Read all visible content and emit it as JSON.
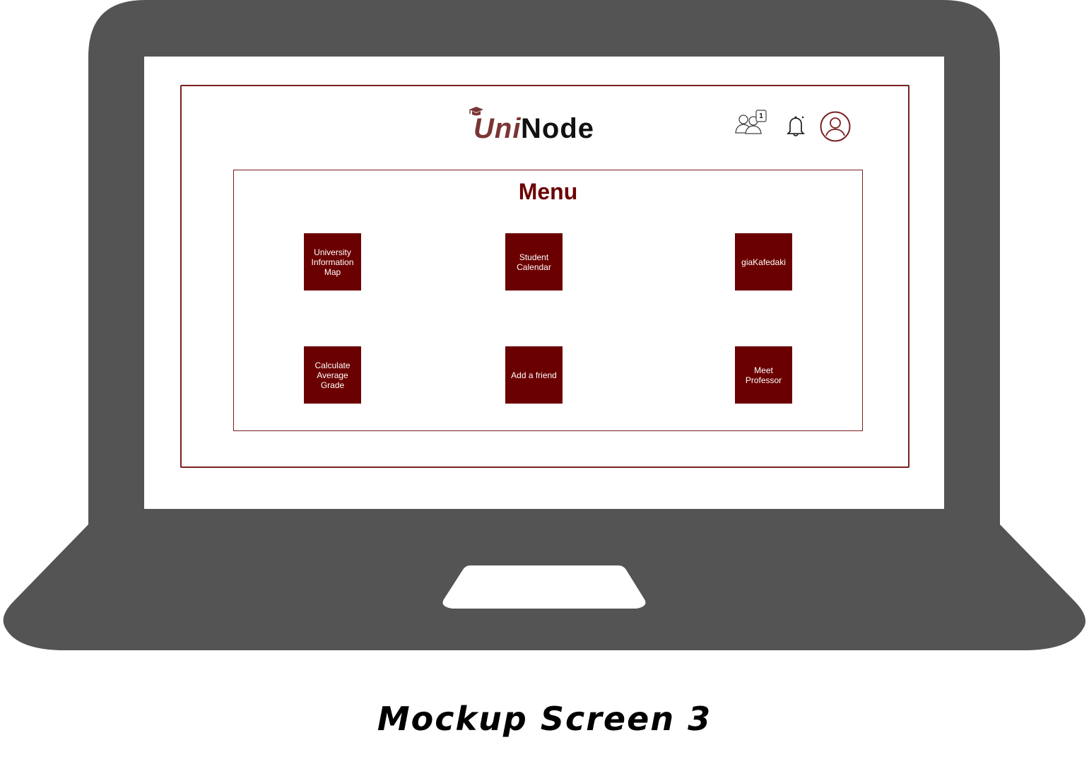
{
  "brand": {
    "part1": "Uni",
    "part2": "Node",
    "accent_color": "#7a3535"
  },
  "header": {
    "friends_icon": "friends-icon",
    "friend_requests_count": "1",
    "notifications_icon": "bell-icon",
    "profile_icon": "user-profile-icon"
  },
  "menu": {
    "title": "Menu",
    "tile_color": "#6b0000",
    "tiles": [
      {
        "label": "University Information Map"
      },
      {
        "label": "Student Calendar"
      },
      {
        "label": "giaKafedaki"
      },
      {
        "label": "Calculate Average Grade"
      },
      {
        "label": "Add a friend"
      },
      {
        "label": "Meet Professor"
      }
    ]
  },
  "caption": "Mockup Screen 3",
  "laptop_color": "#545454"
}
